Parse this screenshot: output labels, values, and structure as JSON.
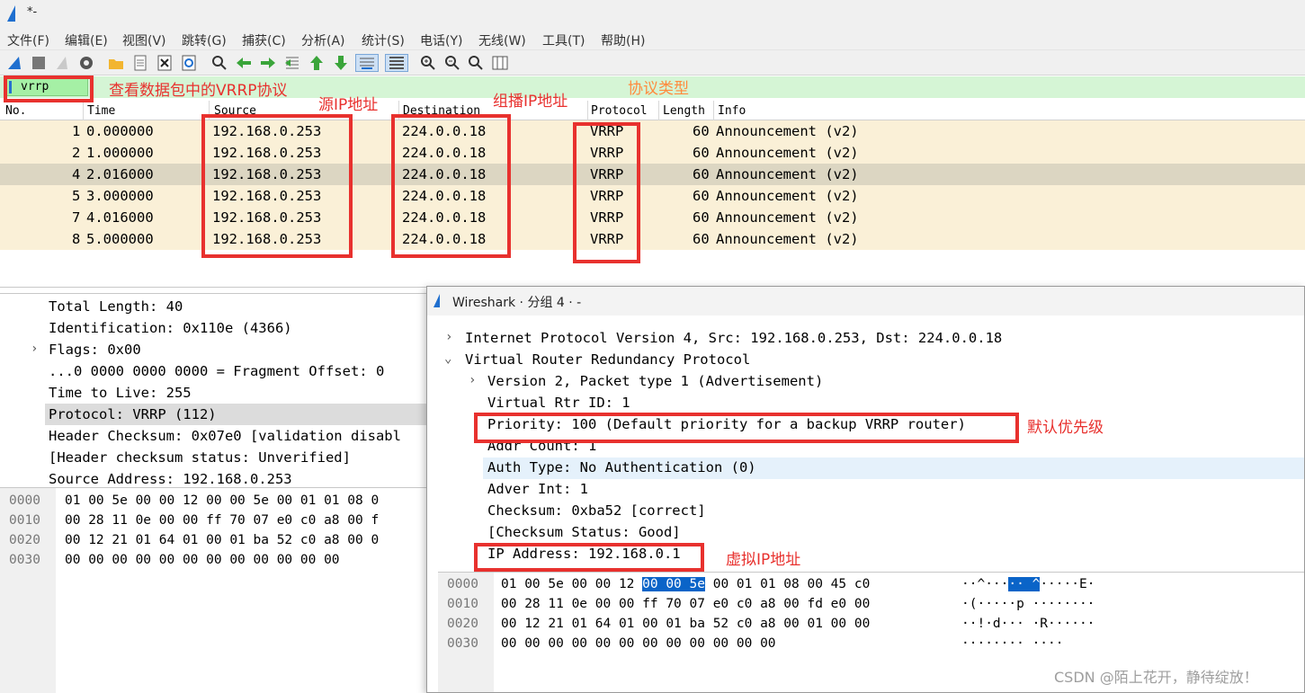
{
  "window": {
    "title": "*-"
  },
  "menu": [
    "文件(F)",
    "编辑(E)",
    "视图(V)",
    "跳转(G)",
    "捕获(C)",
    "分析(A)",
    "统计(S)",
    "电话(Y)",
    "无线(W)",
    "工具(T)",
    "帮助(H)"
  ],
  "toolbar_icons": [
    "shark-fin-icon",
    "stop-icon",
    "restart-icon",
    "options-gear-icon",
    "open-folder-icon",
    "save-file-icon",
    "close-file-icon",
    "reload-icon",
    "find-icon",
    "go-back-icon",
    "go-forward-icon",
    "go-to-packet-icon",
    "first-packet-icon",
    "last-packet-icon",
    "autoscroll-icon",
    "colorize-icon",
    "zoom-in-icon",
    "zoom-out-icon",
    "normal-size-icon",
    "resize-columns-icon"
  ],
  "filter": {
    "value": "vrrp"
  },
  "columns": {
    "no": "No.",
    "time": "Time",
    "source": "Source",
    "destination": "Destination",
    "protocol": "Protocol",
    "length": "Length",
    "info": "Info"
  },
  "packets": [
    {
      "no": "1",
      "time": "0.000000",
      "source": "192.168.0.253",
      "destination": "224.0.0.18",
      "protocol": "VRRP",
      "length": "60",
      "info": "Announcement (v2)"
    },
    {
      "no": "2",
      "time": "1.000000",
      "source": "192.168.0.253",
      "destination": "224.0.0.18",
      "protocol": "VRRP",
      "length": "60",
      "info": "Announcement (v2)"
    },
    {
      "no": "4",
      "time": "2.016000",
      "source": "192.168.0.253",
      "destination": "224.0.0.18",
      "protocol": "VRRP",
      "length": "60",
      "info": "Announcement (v2)"
    },
    {
      "no": "5",
      "time": "3.000000",
      "source": "192.168.0.253",
      "destination": "224.0.0.18",
      "protocol": "VRRP",
      "length": "60",
      "info": "Announcement (v2)"
    },
    {
      "no": "7",
      "time": "4.016000",
      "source": "192.168.0.253",
      "destination": "224.0.0.18",
      "protocol": "VRRP",
      "length": "60",
      "info": "Announcement (v2)"
    },
    {
      "no": "8",
      "time": "5.000000",
      "source": "192.168.0.253",
      "destination": "224.0.0.18",
      "protocol": "VRRP",
      "length": "60",
      "info": "Announcement (v2)"
    }
  ],
  "detail": [
    "Total Length: 40",
    "Identification: 0x110e (4366)",
    "Flags: 0x00",
    "...0 0000 0000 0000 = Fragment Offset: 0",
    "Time to Live: 255",
    "Protocol: VRRP (112)",
    "Header Checksum: 0x07e0 [validation disabl",
    "[Header checksum status: Unverified]",
    "Source Address: 192.168.0.253"
  ],
  "hex": [
    {
      "offset": "0000",
      "bytes": "01 00 5e 00 00 12 00 00  5e 00 01 01 08 0"
    },
    {
      "offset": "0010",
      "bytes": "00 28 11 0e 00 00 ff 70  07 e0 c0 a8 00 f"
    },
    {
      "offset": "0020",
      "bytes": "00 12 21 01 64 01 00 01  ba 52 c0 a8 00 0"
    },
    {
      "offset": "0030",
      "bytes": "00 00 00 00 00 00 00 00  00 00 00 00"
    }
  ],
  "popup": {
    "title": "Wireshark · 分组 4 · -",
    "tree": [
      "Internet Protocol Version 4, Src: 192.168.0.253, Dst: 224.0.0.18",
      "Virtual Router Redundancy Protocol",
      "Version 2, Packet type 1 (Advertisement)",
      "Virtual Rtr ID: 1",
      "Priority: 100 (Default priority for a backup VRRP router)",
      "Addr Count: 1",
      "Auth Type: No Authentication (0)",
      "Adver Int: 1",
      "Checksum: 0xba52 [correct]",
      "[Checksum Status: Good]",
      "IP Address: 192.168.0.1"
    ],
    "hex": [
      {
        "offset": "0000",
        "pre": "01 00 5e 00 00 12 ",
        "sel": "00 00  5e",
        "post": " 00 01 01 08 00 45 c0",
        "ascii_pre": "··^···",
        "ascii_sel": "·· ^",
        "ascii_post": "·····E·"
      },
      {
        "offset": "0010",
        "pre": "00 28 11 0e 00 00 ff 70  07 e0 c0 a8 00 fd e0 00",
        "sel": "",
        "post": "",
        "ascii_pre": "·(·····p ········",
        "ascii_sel": "",
        "ascii_post": ""
      },
      {
        "offset": "0020",
        "pre": "00 12 21 01 64 01 00 01  ba 52 c0 a8 00 01 00 00",
        "sel": "",
        "post": "",
        "ascii_pre": "··!·d··· ·R······",
        "ascii_sel": "",
        "ascii_post": ""
      },
      {
        "offset": "0030",
        "pre": "00 00 00 00 00 00 00 00  00 00 00 00",
        "sel": "",
        "post": "",
        "ascii_pre": "········ ····",
        "ascii_sel": "",
        "ascii_post": ""
      }
    ]
  },
  "annotations": {
    "filter": "查看数据包中的VRRP协议",
    "source": "源IP地址",
    "destination": "组播IP地址",
    "protocol": "协议类型",
    "priority": "默认优先级",
    "vip": "虚拟IP地址"
  },
  "watermark": "CSDN @陌上花开，静待绽放！",
  "colors": {
    "annotation_red": "#e8312e",
    "row_bg": "#faf0d7",
    "row_selected": "#dcd6c2",
    "filter_ok": "#a5f0a5",
    "hex_highlight": "#0a64c8"
  }
}
